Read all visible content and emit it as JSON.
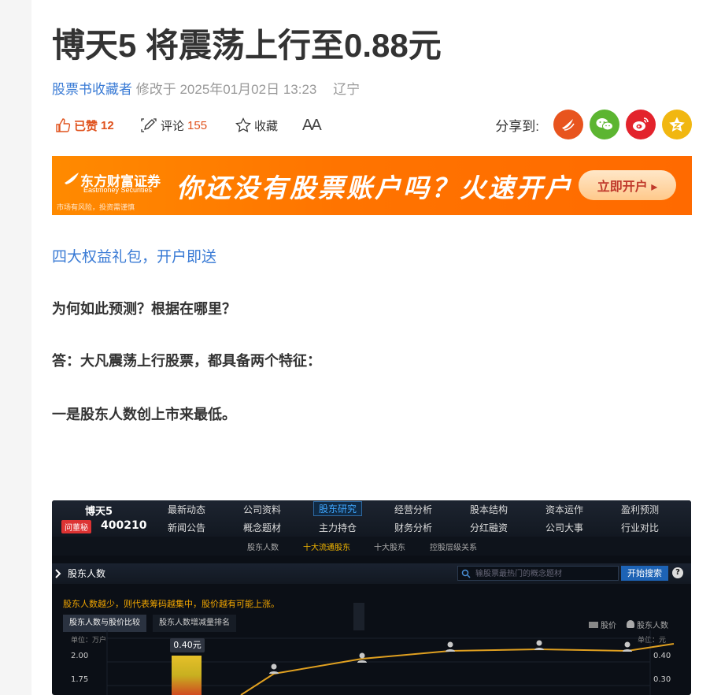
{
  "article": {
    "title": "博天5 将震荡上行至0.88元",
    "author": "股票书收藏者",
    "modified": "修改于 2025年01月02日 13:23",
    "location": "辽宁"
  },
  "actions": {
    "like_label": "已赞",
    "like_count": "12",
    "comment_label": "评论",
    "comment_count": "155",
    "favorite_label": "收藏",
    "font_label": "AA",
    "share_label": "分享到:"
  },
  "banner": {
    "brand": "东方财富证券",
    "brand_en": "Eastmoney Securities",
    "risk": "市场有风险，投资需谨慎",
    "headline": "你还没有股票账户吗？火速开户",
    "button": "立即开户 ▸"
  },
  "body": {
    "promo_link": "四大权益礼包，开户即送",
    "q1": "为何如此预测？根据在哪里？",
    "a1": "答：大凡震荡上行股票，都具备两个特征：",
    "p1": "一是股东人数创上市来最低。"
  },
  "screenshot": {
    "stock_name": "博天5",
    "stock_tag": "问董秘",
    "stock_code": "400210",
    "nav_row1": [
      "最新动态",
      "公司资料",
      "股东研究",
      "经营分析",
      "股本结构",
      "资本运作",
      "盈利预测"
    ],
    "nav_row2": [
      "新闻公告",
      "概念题材",
      "主力持仓",
      "财务分析",
      "分红融资",
      "公司大事",
      "行业对比"
    ],
    "subnav": [
      "股东人数",
      "十大流通股东",
      "十大股东",
      "控股层级关系"
    ],
    "section_title": "股东人数",
    "search_placeholder": "输股票最热门的概念题材",
    "search_button": "开始搜索",
    "help": "?",
    "notice": "股东人数越少，则代表筹码越集中，股价越有可能上涨。",
    "tabs": [
      "股东人数与股价比较",
      "股东人数增减量排名"
    ],
    "legend_price": "股价",
    "legend_holders": "股东人数",
    "unit_left": "单位：万户",
    "unit_right": "单位：元",
    "left_axis": [
      "2.00",
      "1.75"
    ],
    "right_axis": [
      "0.40",
      "0.30"
    ],
    "tooltip": "0.40元"
  },
  "colors": {
    "link": "#3a7bd5",
    "accent": "#e0531e",
    "banner": "#ff7a00",
    "line": "#e0a020"
  }
}
